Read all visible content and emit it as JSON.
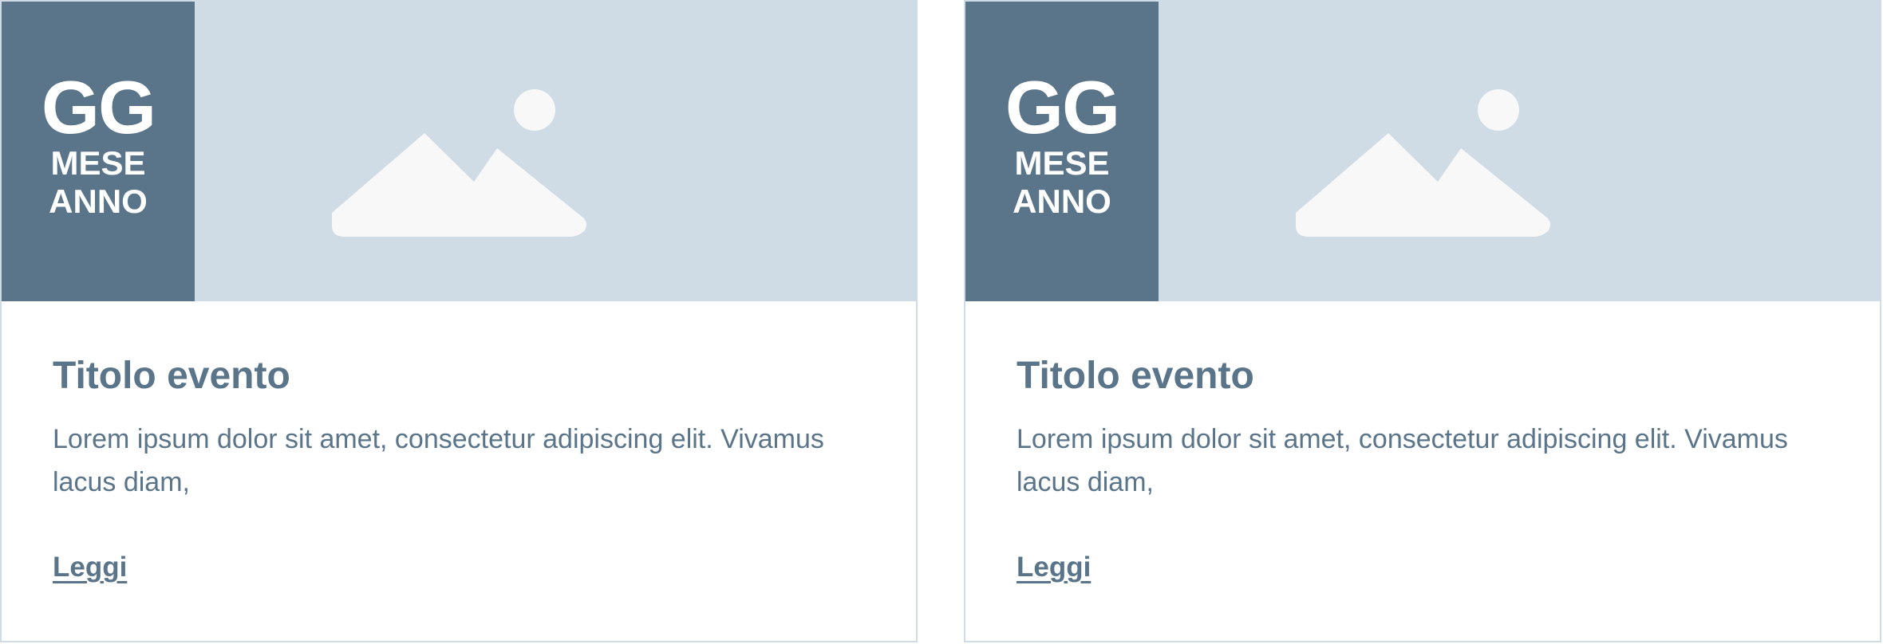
{
  "cards": [
    {
      "date": {
        "day": "GG",
        "month": "MESE",
        "year": "ANNO"
      },
      "image_icon": "image-placeholder-icon",
      "title": "Titolo evento",
      "text": "Lorem ipsum dolor sit amet, consectetur adipiscing elit. Vivamus lacus diam,",
      "link_label": "Leggi"
    },
    {
      "date": {
        "day": "GG",
        "month": "MESE",
        "year": "ANNO"
      },
      "image_icon": "image-placeholder-icon",
      "title": "Titolo evento",
      "text": "Lorem ipsum dolor sit amet, consectetur adipiscing elit. Vivamus lacus diam,",
      "link_label": "Leggi"
    }
  ],
  "colors": {
    "accent": "#5a7489",
    "media_background": "#cfdce5",
    "icon": "#f8f8f8",
    "border": "#cfdce5"
  }
}
